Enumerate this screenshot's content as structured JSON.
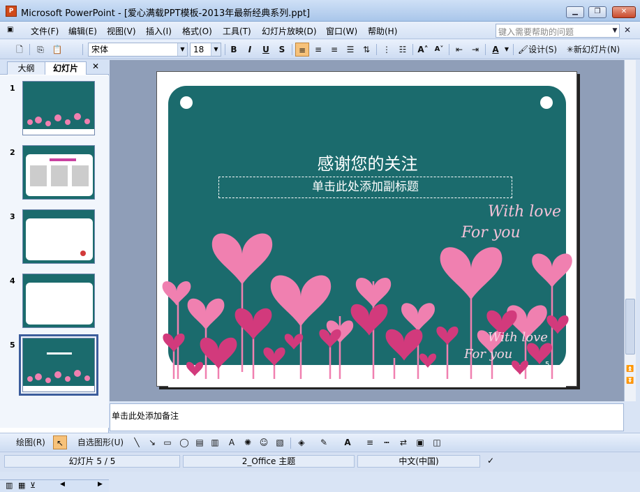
{
  "window": {
    "title": "Microsoft PowerPoint - [爱心满载PPT模板-2013年最新经典系列.ppt]"
  },
  "menu": {
    "items": [
      "文件(F)",
      "编辑(E)",
      "视图(V)",
      "插入(I)",
      "格式(O)",
      "工具(T)",
      "幻灯片放映(D)",
      "窗口(W)",
      "帮助(H)"
    ],
    "help_placeholder": "键入需要帮助的问题"
  },
  "toolbar": {
    "font": "宋体",
    "font_size": "18",
    "design_label": "设计(S)",
    "new_slide_label": "新幻灯片(N)"
  },
  "side_panel": {
    "tabs": [
      "大纲",
      "幻灯片"
    ],
    "slides": [
      {
        "number": "1"
      },
      {
        "number": "2"
      },
      {
        "number": "3"
      },
      {
        "number": "4"
      },
      {
        "number": "5",
        "selected": true
      }
    ]
  },
  "slide": {
    "title": "感谢您的关注",
    "subtitle_placeholder": "单击此处添加副标题",
    "script_line1": "With love",
    "script_line2": "For you",
    "page_number": "5",
    "colors": {
      "background": "#1b6b6d",
      "heart": "#f080b0",
      "heart_dark": "#d23a7c"
    }
  },
  "notes": {
    "placeholder": "单击此处添加备注"
  },
  "drawing_toolbar": {
    "draw_label": "绘图(R)",
    "autoshapes_label": "自选图形(U)"
  },
  "status": {
    "slide": "幻灯片 5 / 5",
    "theme": "2_Office 主题",
    "language": "中文(中国)"
  }
}
